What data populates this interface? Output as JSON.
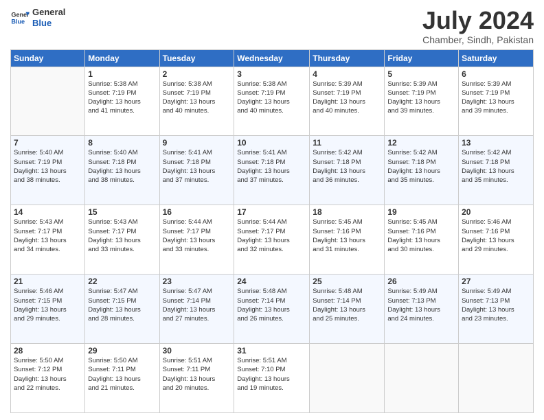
{
  "logo": {
    "line1": "General",
    "line2": "Blue"
  },
  "title": "July 2024",
  "subtitle": "Chamber, Sindh, Pakistan",
  "header_days": [
    "Sunday",
    "Monday",
    "Tuesday",
    "Wednesday",
    "Thursday",
    "Friday",
    "Saturday"
  ],
  "weeks": [
    [
      {
        "day": "",
        "info": ""
      },
      {
        "day": "1",
        "info": "Sunrise: 5:38 AM\nSunset: 7:19 PM\nDaylight: 13 hours\nand 41 minutes."
      },
      {
        "day": "2",
        "info": "Sunrise: 5:38 AM\nSunset: 7:19 PM\nDaylight: 13 hours\nand 40 minutes."
      },
      {
        "day": "3",
        "info": "Sunrise: 5:38 AM\nSunset: 7:19 PM\nDaylight: 13 hours\nand 40 minutes."
      },
      {
        "day": "4",
        "info": "Sunrise: 5:39 AM\nSunset: 7:19 PM\nDaylight: 13 hours\nand 40 minutes."
      },
      {
        "day": "5",
        "info": "Sunrise: 5:39 AM\nSunset: 7:19 PM\nDaylight: 13 hours\nand 39 minutes."
      },
      {
        "day": "6",
        "info": "Sunrise: 5:39 AM\nSunset: 7:19 PM\nDaylight: 13 hours\nand 39 minutes."
      }
    ],
    [
      {
        "day": "7",
        "info": "Sunrise: 5:40 AM\nSunset: 7:19 PM\nDaylight: 13 hours\nand 38 minutes."
      },
      {
        "day": "8",
        "info": "Sunrise: 5:40 AM\nSunset: 7:18 PM\nDaylight: 13 hours\nand 38 minutes."
      },
      {
        "day": "9",
        "info": "Sunrise: 5:41 AM\nSunset: 7:18 PM\nDaylight: 13 hours\nand 37 minutes."
      },
      {
        "day": "10",
        "info": "Sunrise: 5:41 AM\nSunset: 7:18 PM\nDaylight: 13 hours\nand 37 minutes."
      },
      {
        "day": "11",
        "info": "Sunrise: 5:42 AM\nSunset: 7:18 PM\nDaylight: 13 hours\nand 36 minutes."
      },
      {
        "day": "12",
        "info": "Sunrise: 5:42 AM\nSunset: 7:18 PM\nDaylight: 13 hours\nand 35 minutes."
      },
      {
        "day": "13",
        "info": "Sunrise: 5:42 AM\nSunset: 7:18 PM\nDaylight: 13 hours\nand 35 minutes."
      }
    ],
    [
      {
        "day": "14",
        "info": "Sunrise: 5:43 AM\nSunset: 7:17 PM\nDaylight: 13 hours\nand 34 minutes."
      },
      {
        "day": "15",
        "info": "Sunrise: 5:43 AM\nSunset: 7:17 PM\nDaylight: 13 hours\nand 33 minutes."
      },
      {
        "day": "16",
        "info": "Sunrise: 5:44 AM\nSunset: 7:17 PM\nDaylight: 13 hours\nand 33 minutes."
      },
      {
        "day": "17",
        "info": "Sunrise: 5:44 AM\nSunset: 7:17 PM\nDaylight: 13 hours\nand 32 minutes."
      },
      {
        "day": "18",
        "info": "Sunrise: 5:45 AM\nSunset: 7:16 PM\nDaylight: 13 hours\nand 31 minutes."
      },
      {
        "day": "19",
        "info": "Sunrise: 5:45 AM\nSunset: 7:16 PM\nDaylight: 13 hours\nand 30 minutes."
      },
      {
        "day": "20",
        "info": "Sunrise: 5:46 AM\nSunset: 7:16 PM\nDaylight: 13 hours\nand 29 minutes."
      }
    ],
    [
      {
        "day": "21",
        "info": "Sunrise: 5:46 AM\nSunset: 7:15 PM\nDaylight: 13 hours\nand 29 minutes."
      },
      {
        "day": "22",
        "info": "Sunrise: 5:47 AM\nSunset: 7:15 PM\nDaylight: 13 hours\nand 28 minutes."
      },
      {
        "day": "23",
        "info": "Sunrise: 5:47 AM\nSunset: 7:14 PM\nDaylight: 13 hours\nand 27 minutes."
      },
      {
        "day": "24",
        "info": "Sunrise: 5:48 AM\nSunset: 7:14 PM\nDaylight: 13 hours\nand 26 minutes."
      },
      {
        "day": "25",
        "info": "Sunrise: 5:48 AM\nSunset: 7:14 PM\nDaylight: 13 hours\nand 25 minutes."
      },
      {
        "day": "26",
        "info": "Sunrise: 5:49 AM\nSunset: 7:13 PM\nDaylight: 13 hours\nand 24 minutes."
      },
      {
        "day": "27",
        "info": "Sunrise: 5:49 AM\nSunset: 7:13 PM\nDaylight: 13 hours\nand 23 minutes."
      }
    ],
    [
      {
        "day": "28",
        "info": "Sunrise: 5:50 AM\nSunset: 7:12 PM\nDaylight: 13 hours\nand 22 minutes."
      },
      {
        "day": "29",
        "info": "Sunrise: 5:50 AM\nSunset: 7:11 PM\nDaylight: 13 hours\nand 21 minutes."
      },
      {
        "day": "30",
        "info": "Sunrise: 5:51 AM\nSunset: 7:11 PM\nDaylight: 13 hours\nand 20 minutes."
      },
      {
        "day": "31",
        "info": "Sunrise: 5:51 AM\nSunset: 7:10 PM\nDaylight: 13 hours\nand 19 minutes."
      },
      {
        "day": "",
        "info": ""
      },
      {
        "day": "",
        "info": ""
      },
      {
        "day": "",
        "info": ""
      }
    ]
  ]
}
